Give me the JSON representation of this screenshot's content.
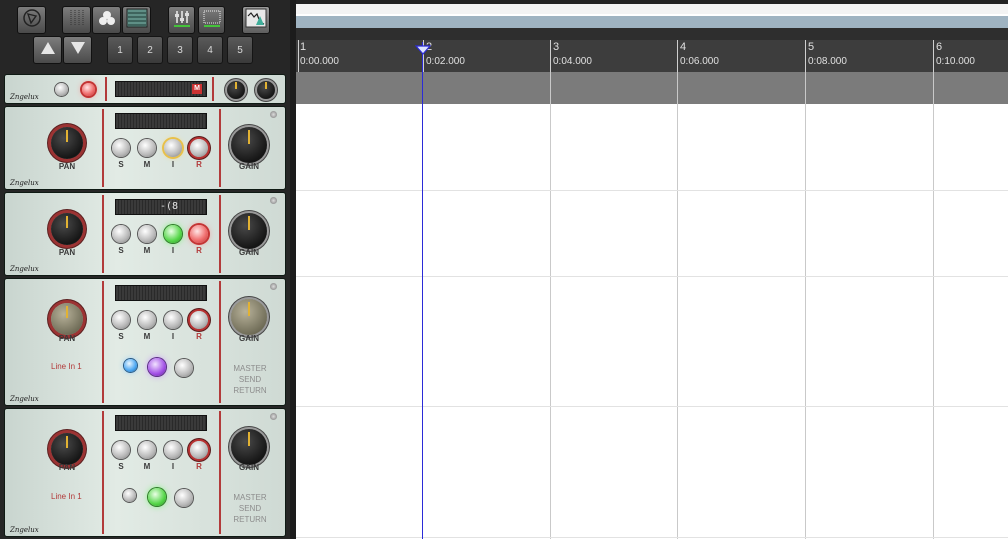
{
  "toolbar": {
    "layout_buttons": [
      "1",
      "2",
      "3",
      "4",
      "5"
    ],
    "icons": [
      "logo-icon",
      "grid-icon",
      "group-icon",
      "list-icon",
      "mixer-icon",
      "meter-icon",
      "envelope-icon",
      "arrow-up-icon",
      "arrow-down-icon"
    ]
  },
  "master": {
    "mute_badge": "M"
  },
  "tracks": [
    {
      "pan_label": "PAN",
      "gain_label": "GAIN",
      "btn_s": "S",
      "btn_m": "M",
      "btn_i": "I",
      "btn_r": "R",
      "level": ""
    },
    {
      "pan_label": "PAN",
      "gain_label": "GAIN",
      "btn_s": "S",
      "btn_m": "M",
      "btn_i": "I",
      "btn_r": "R",
      "level": "-(8"
    },
    {
      "pan_label": "PAN",
      "gain_label": "GAIN",
      "btn_s": "S",
      "btn_m": "M",
      "btn_i": "I",
      "btn_r": "R",
      "level": "",
      "input": "Line In 1",
      "master_send_return": [
        "MASTER",
        "SEND",
        "RETURN"
      ]
    },
    {
      "pan_label": "PAN",
      "gain_label": "GAIN",
      "btn_s": "S",
      "btn_m": "M",
      "btn_i": "I",
      "btn_r": "R",
      "level": "",
      "input": "Line In 1",
      "master_send_return": [
        "MASTER",
        "SEND",
        "RETURN"
      ]
    }
  ],
  "brand": "Zngelux",
  "ruler": {
    "marks": [
      {
        "bar": "1",
        "time": "0:00.000"
      },
      {
        "bar": "2",
        "time": "0:02.000"
      },
      {
        "bar": "3",
        "time": "0:04.000"
      },
      {
        "bar": "4",
        "time": "0:06.000"
      },
      {
        "bar": "5",
        "time": "0:08.000"
      },
      {
        "bar": "6",
        "time": "0:10.000"
      }
    ]
  },
  "colors": {
    "accent_red": "#b23a3a",
    "playhead": "#2b2bd8",
    "led_green": "#54d648",
    "led_purple": "#a24fe6",
    "led_blue": "#4aa6f2"
  }
}
